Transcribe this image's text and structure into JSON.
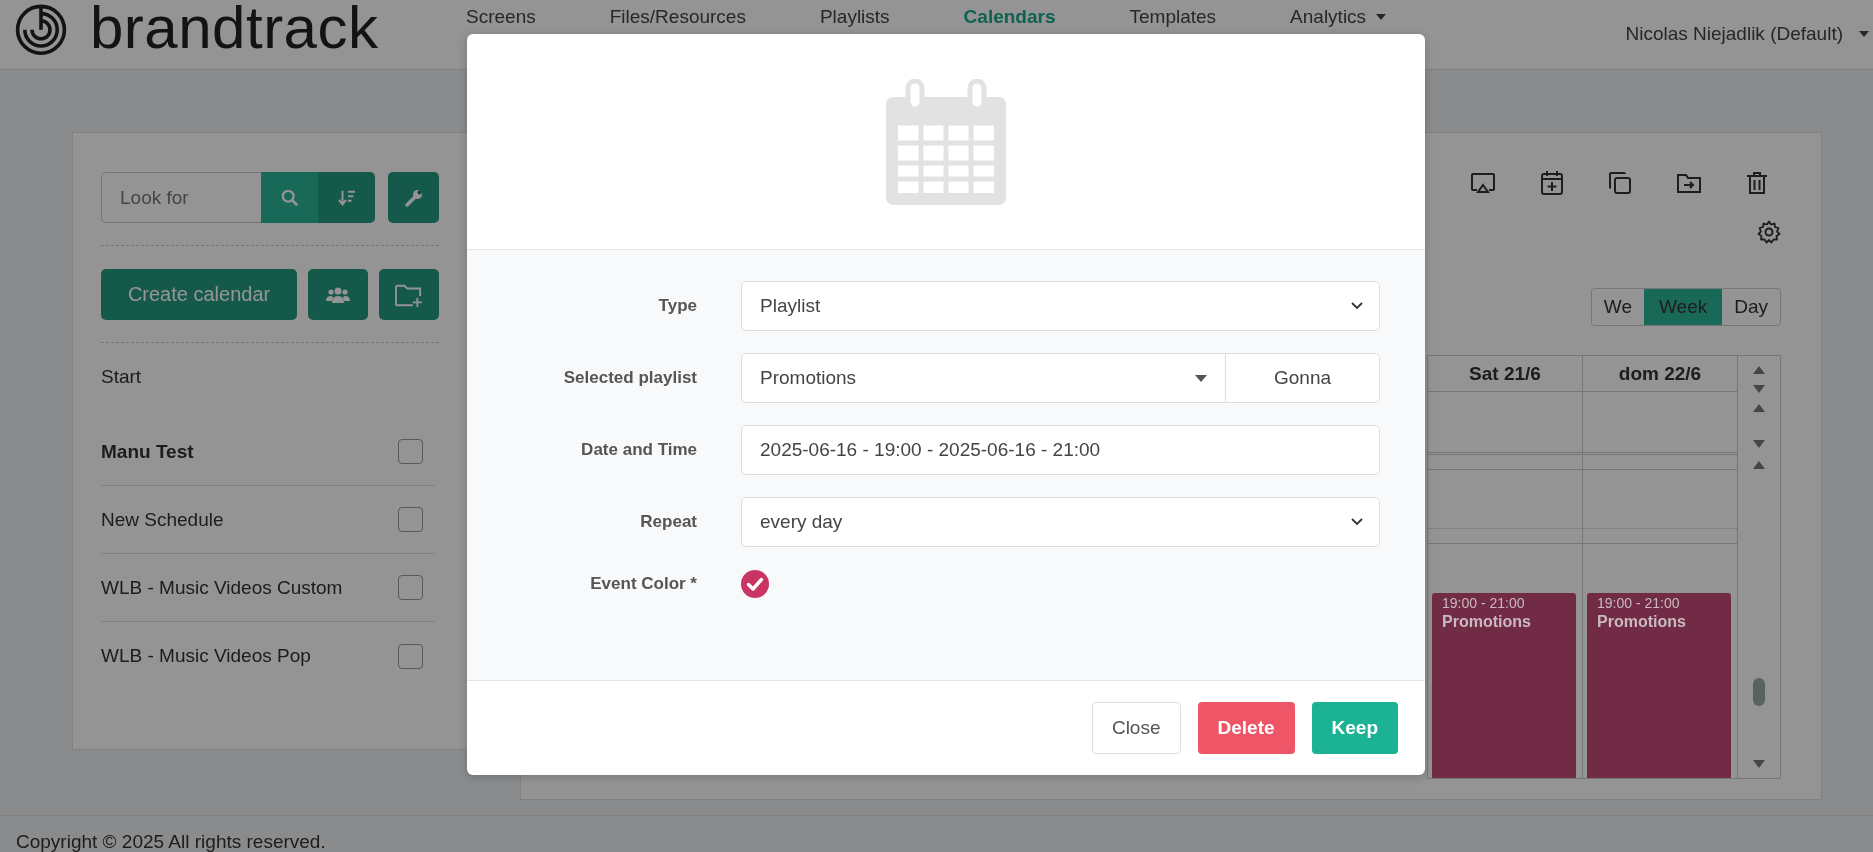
{
  "header": {
    "logo": "brandtrack",
    "nav": [
      {
        "label": "Screens",
        "selected": false,
        "has_menu": false
      },
      {
        "label": "Files/Resources",
        "selected": false,
        "has_menu": false
      },
      {
        "label": "Playlists",
        "selected": false,
        "has_menu": false
      },
      {
        "label": "Calendars",
        "selected": true,
        "has_menu": false
      },
      {
        "label": "Templates",
        "selected": false,
        "has_menu": false
      },
      {
        "label": "Analytics",
        "selected": false,
        "has_menu": true
      }
    ],
    "user_menu": "Nicolas Niejadlik (Default)"
  },
  "sidebar": {
    "search": {
      "placeholder": "Look for"
    },
    "create_button": "Create calendar",
    "section_label": "Start",
    "calendars": [
      {
        "name": "Manu Test",
        "selected": true,
        "checked": false
      },
      {
        "name": "New Schedule",
        "selected": false,
        "checked": false
      },
      {
        "name": "WLB - Music Videos Custom",
        "selected": false,
        "checked": false
      },
      {
        "name": "WLB - Music Videos Pop",
        "selected": false,
        "checked": false
      }
    ]
  },
  "calendar": {
    "views": [
      {
        "label": "We",
        "selected": false
      },
      {
        "label": "Week",
        "selected": true
      },
      {
        "label": "Day",
        "selected": false
      }
    ],
    "days": [
      {
        "label": "Sat 21/6",
        "events": [
          {
            "time": "19:00 - 21:00",
            "title": "Promotions",
            "color": "#722b45"
          }
        ]
      },
      {
        "label": "dom 22/6",
        "events": [
          {
            "time": "19:00 - 21:00",
            "title": "Promotions",
            "color": "#722b45"
          }
        ]
      }
    ]
  },
  "modal": {
    "fields": [
      {
        "label": "Type",
        "kind": "select",
        "value": "Playlist"
      },
      {
        "label": "Selected playlist",
        "kind": "combo",
        "value": "Promotions",
        "addon": "Gonna"
      },
      {
        "label": "Date and Time",
        "kind": "text",
        "value": "2025-06-16 - 19:00 - 2025-06-16 - 21:00"
      },
      {
        "label": "Repeat",
        "kind": "select",
        "value": "every day"
      },
      {
        "label": "Event Color *",
        "kind": "color",
        "color": "#c93463",
        "checked": true
      }
    ],
    "buttons": [
      {
        "label": "Close",
        "kind": "default"
      },
      {
        "label": "Delete",
        "kind": "danger"
      },
      {
        "label": "Keep",
        "kind": "primary"
      }
    ]
  },
  "footer": "Copyright © 2025 All rights reserved."
}
